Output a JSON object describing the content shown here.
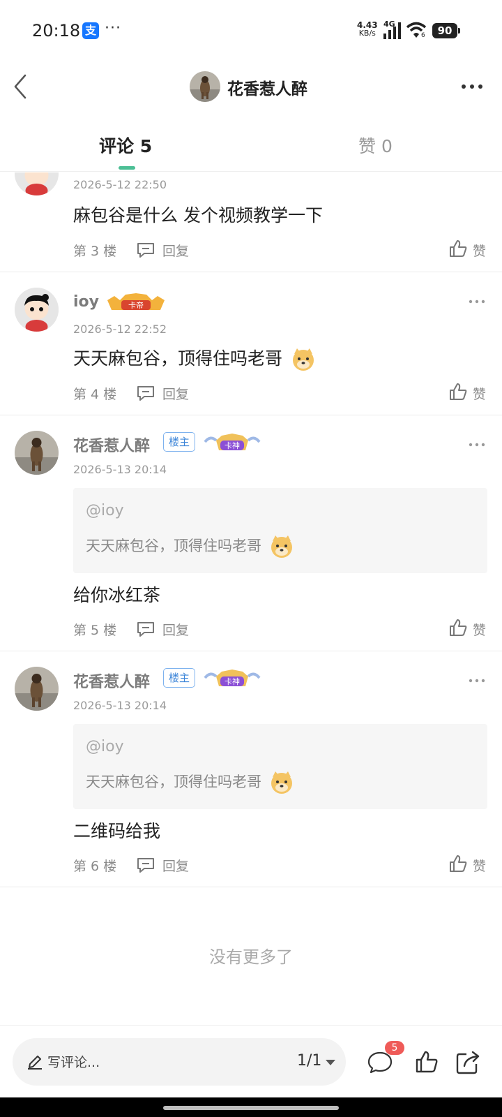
{
  "status_bar": {
    "time": "20:18",
    "app_icon_label": "支",
    "more_dots": "···",
    "net_speed_value": "4.43",
    "net_speed_unit": "KB/s",
    "network_type": "4G",
    "wifi_number": "6",
    "battery": "90"
  },
  "header": {
    "title": "花香惹人醉"
  },
  "tabs": {
    "comments_label": "评论 5",
    "likes_label": "赞 0"
  },
  "comments": [
    {
      "time": "2026-5-12 22:50",
      "text": "麻包谷是什么 发个视频教学一下",
      "floor": "第 3 楼",
      "reply": "回复",
      "like": "赞"
    },
    {
      "username": "ioy",
      "crown_text": "卡帝",
      "time": "2026-5-12 22:52",
      "text": "天天麻包谷，顶得住吗老哥",
      "floor": "第 4 楼",
      "reply": "回复",
      "like": "赞"
    },
    {
      "username": "花香惹人醉",
      "badge": "楼主",
      "crown_text": "卡神",
      "time": "2026-5-13 20:14",
      "quote_at": "@ioy",
      "quote_text": "天天麻包谷，顶得住吗老哥",
      "text": "给你冰红茶",
      "floor": "第 5 楼",
      "reply": "回复",
      "like": "赞"
    },
    {
      "username": "花香惹人醉",
      "badge": "楼主",
      "crown_text": "卡神",
      "time": "2026-5-13 20:14",
      "quote_at": "@ioy",
      "quote_text": "天天麻包谷，顶得住吗老哥",
      "text": "二维码给我",
      "floor": "第 6 楼",
      "reply": "回复",
      "like": "赞"
    }
  ],
  "no_more": "没有更多了",
  "bottom_bar": {
    "placeholder": "写评论...",
    "page_indicator": "1/1",
    "comment_count_badge": "5"
  },
  "colors": {
    "accent": "#4cbf95",
    "badge_red": "#ef5b58",
    "owner_badge_blue": "#3b84d8"
  }
}
